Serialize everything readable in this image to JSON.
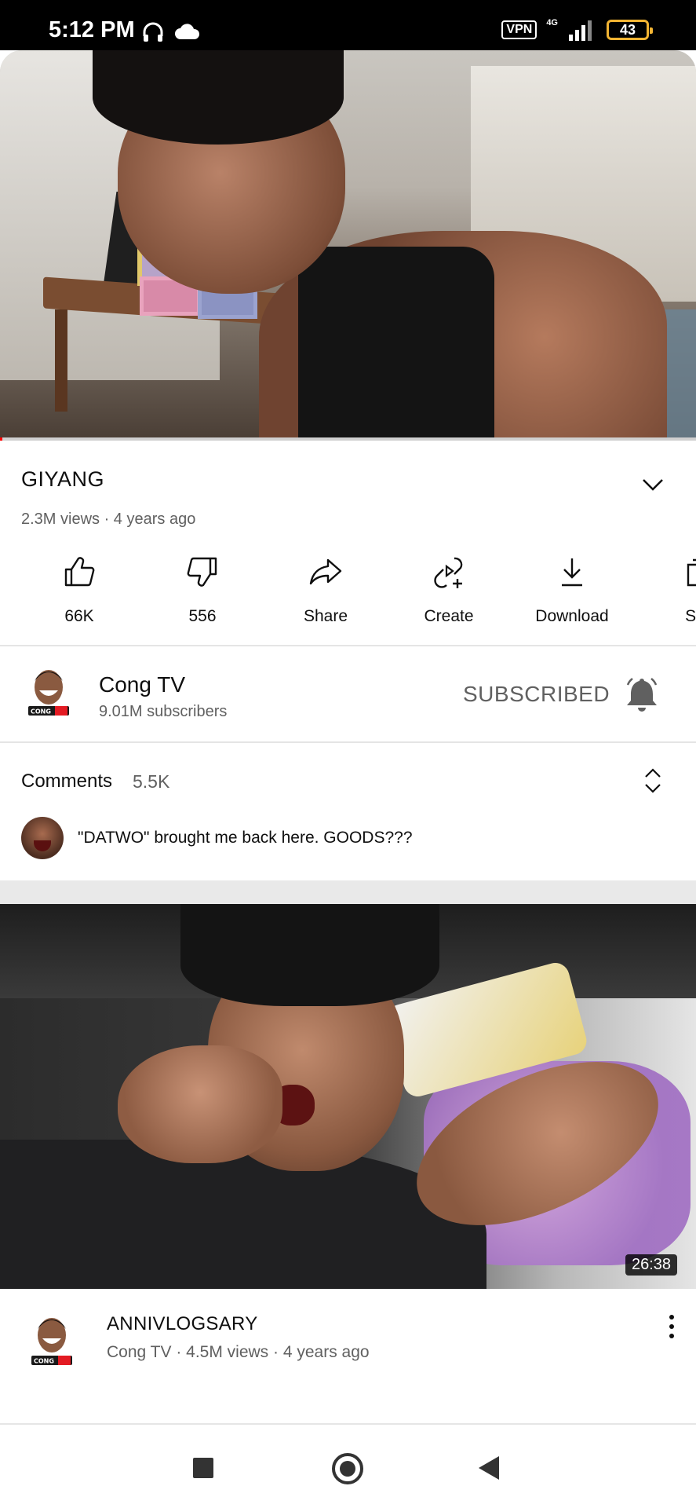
{
  "status_bar": {
    "time": "5:12 PM",
    "vpn": "VPN",
    "network": "4G",
    "battery": "43"
  },
  "player": {
    "progress": 0.003,
    "progress_color": "#ff0000"
  },
  "video": {
    "title": "GIYANG",
    "meta": "2.3M views · 4 years ago"
  },
  "actions": [
    {
      "label": "66K",
      "icon": "thumbs-up-icon"
    },
    {
      "label": "556",
      "icon": "thumbs-down-icon"
    },
    {
      "label": "Share",
      "icon": "share-icon"
    },
    {
      "label": "Create",
      "icon": "create-icon"
    },
    {
      "label": "Download",
      "icon": "download-icon"
    },
    {
      "label": "Sa",
      "icon": "save-icon"
    }
  ],
  "channel": {
    "name": "Cong TV",
    "subscribers": "9.01M subscribers",
    "subscribe_label": "SUBSCRIBED",
    "avatar_text": "CONG"
  },
  "comments": {
    "label": "Comments",
    "count": "5.5K",
    "top_comment": "\"DATWO\" brought me back here. GOODS???"
  },
  "next_video": {
    "duration": "26:38",
    "title": "ANNIVLOGSARY",
    "meta": "Cong TV · 4.5M views · 4 years ago"
  },
  "colors": {
    "accent": "#ff0000",
    "text_secondary": "#606060",
    "battery": "#f2b433"
  }
}
